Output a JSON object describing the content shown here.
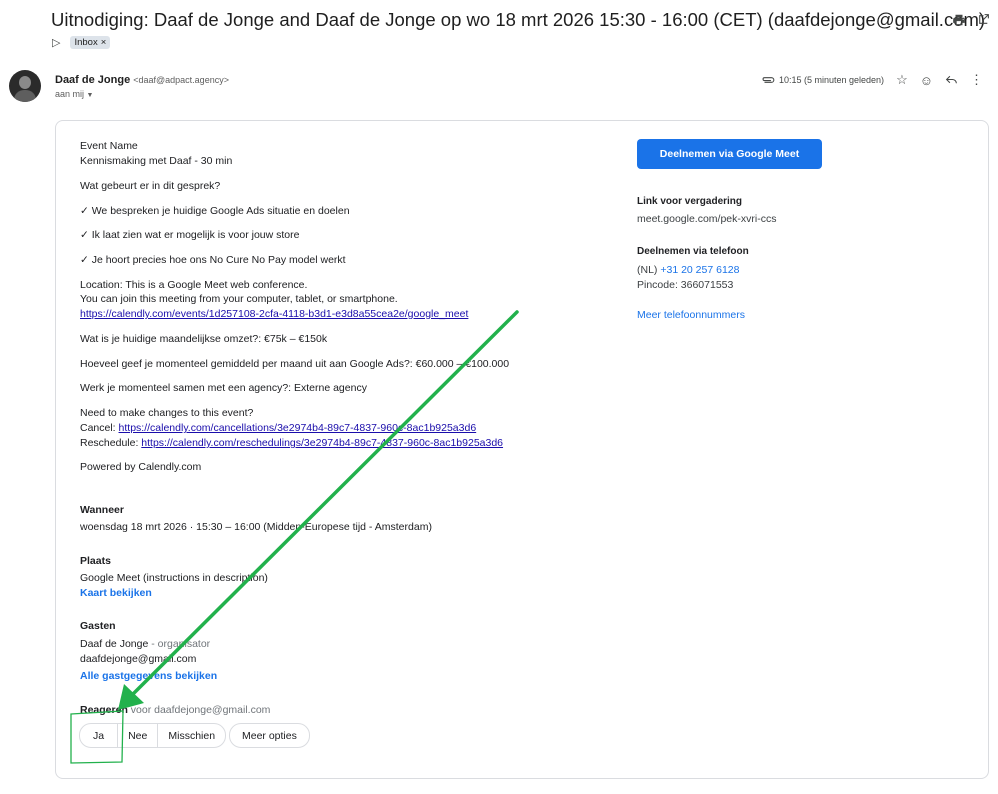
{
  "email": {
    "subject": "Uitnodiging: Daaf de Jonge and Daaf de Jonge op wo 18 mrt 2026 15:30 - 16:00 (CET) (daafdejonge@gmail.com)",
    "label": "Inbox",
    "label_close": "×",
    "sender_name": "Daaf de Jonge",
    "sender_email": "<daaf@adpact.agency>",
    "to": "aan mij",
    "timestamp": "10:15 (5 minuten geleden)"
  },
  "icons": {
    "print": "print-icon",
    "popout": "open-in-new-icon",
    "attachment": "attachment-icon",
    "star": "star-icon",
    "emoji": "emoji-icon",
    "reply": "reply-icon",
    "more": "more-vert-icon"
  },
  "body": {
    "event_name_label": "Event Name",
    "event_name_value": "Kennismaking met Daaf - 30 min",
    "q_intro": "Wat gebeurt er in dit gesprek?",
    "point1": "✓ We bespreken je huidige Google Ads situatie en doelen",
    "point2": "✓ Ik laat zien wat er mogelijk is voor jouw store",
    "point3": "✓ Je hoort precies hoe ons No Cure No Pay model werkt",
    "location1": "Location: This is a Google Meet web conference.",
    "location2": "You can join this meeting from your computer, tablet, or smartphone.",
    "location_link": "https://calendly.com/events/1d257108-2cfa-4118-b3d1-e3d8a55cea2e/google_meet",
    "q_revenue": "Wat is je huidige maandelijkse omzet?: €75k – €150k",
    "q_adspend": "Hoeveel geef je momenteel gemiddeld per maand uit aan Google Ads?: €60.000 – €100.000",
    "q_agency": "Werk je momenteel samen met een agency?: Externe agency",
    "changes": "Need to make changes to this event?",
    "cancel_label": "Cancel: ",
    "cancel_link": "https://calendly.com/cancellations/3e2974b4-89c7-4837-960c-8ac1b925a3d6",
    "reschedule_label": "Reschedule: ",
    "reschedule_link": "https://calendly.com/reschedulings/3e2974b4-89c7-4837-960c-8ac1b925a3d6",
    "powered": "Powered by Calendly.com",
    "when_h": "Wanneer",
    "when_v": "woensdag 18 mrt 2026 · 15:30 – 16:00 (Midden-Europese tijd - Amsterdam)",
    "place_h": "Plaats",
    "place_v": "Google Meet (instructions in description)",
    "map_link": "Kaart bekijken",
    "guests_h": "Gasten",
    "guest1_name": "Daaf de Jonge",
    "guest1_role": " - organisator",
    "guest2": "daafdejonge@gmail.com",
    "guests_link": "Alle gastgegevens bekijken",
    "reply_label": "Reageren",
    "reply_for": " voor daafdejonge@gmail.com",
    "rsvp_yes": "Ja",
    "rsvp_no": "Nee",
    "rsvp_maybe": "Misschien",
    "rsvp_more": "Meer opties"
  },
  "meet": {
    "join_button": "Deelnemen via Google Meet",
    "link_h": "Link voor vergadering",
    "link_v": "meet.google.com/pek-xvri-ccs",
    "phone_h": "Deelnemen via telefoon",
    "phone_prefix": "(NL) ",
    "phone_number": "+31 20 257 6128",
    "pin": "Pincode: 366071553",
    "more_numbers": "Meer telefoonnummers"
  },
  "colors": {
    "accent": "#1a73e8",
    "annotation_green": "#22b14c"
  }
}
